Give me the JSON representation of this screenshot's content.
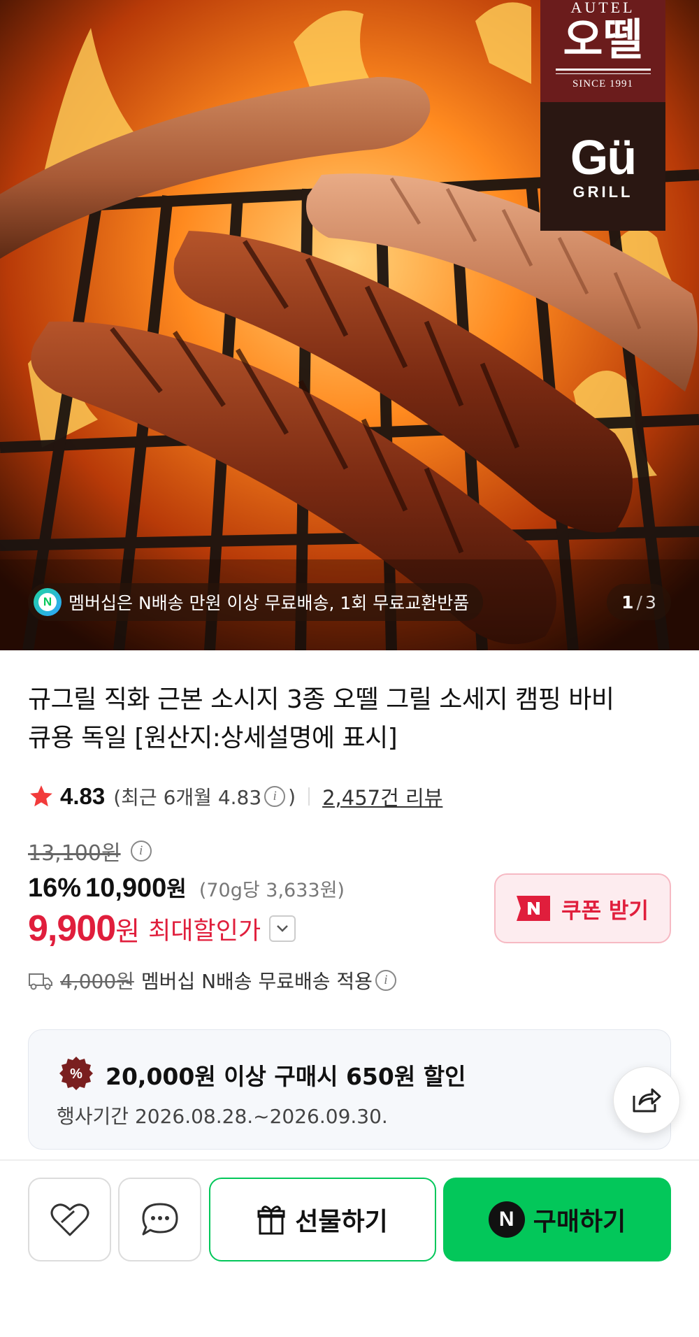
{
  "hero": {
    "brand": {
      "top_small": "AUTEL",
      "top_main": "오뗄",
      "since": "SINCE 1991",
      "gu": "Gü",
      "grill": "GRILL"
    },
    "membership_text": "멤버십은 N배송 만원 이상 무료배송, 1회 무료교환반품",
    "pager": {
      "current": "1",
      "separator": "/",
      "total": "3"
    }
  },
  "product": {
    "title": "규그릴 직화 근본 소시지 3종 오뗄 그릴 소세지 캠핑 바비큐용 독일 [원산지:상세설명에 표시]",
    "rating": "4.83",
    "rating_recent": "(최근 6개월 4.83",
    "rating_recent_close": ")",
    "review_count": "2,457건 리뷰",
    "original_price": "13,100원",
    "discount_percent": "16%",
    "discount_price": "10,900",
    "discount_price_unit": "원",
    "unit_price": "(70g당 3,633원)",
    "final_price": "9,900",
    "final_price_unit": "원",
    "final_price_label": "최대할인가",
    "coupon_label": "쿠폰 받기",
    "delivery_fee_old": "4,000원",
    "delivery_text": "멤버십 N배송 무료배송 적용"
  },
  "promo": {
    "badge": "%",
    "title": "20,000원 이상 구매시 650원 할인",
    "period": "행사기간 2026.08.28.~2026.09.30."
  },
  "actions": {
    "gift_label": "선물하기",
    "buy_label": "구매하기",
    "buy_icon": "N"
  },
  "colors": {
    "accent_red": "#e01e3c",
    "naver_green": "#03c75a",
    "brand_maroon": "#6b1c1c"
  }
}
